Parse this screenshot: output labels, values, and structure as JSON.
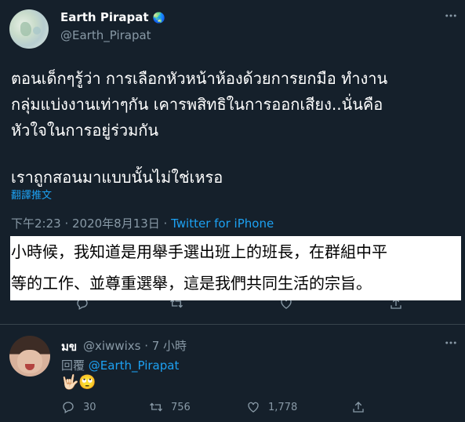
{
  "tweet": {
    "author_name": "Earth Pirapat",
    "verified_emoji": "🌏",
    "handle": "@Earth_Pirapat",
    "text_line1": "ตอนเด็กๆรู้ว่า การเลือกหัวหน้าห้องด้วยการยกมือ ทำงาน",
    "text_line2": "กลุ่มแบ่งงานเท่าๆกัน เคารพสิทธิในการออกเสียง..นั่นคือ",
    "text_line3": "หัวใจในการอยู่ร่วมกัน",
    "text_line4": "เราถูกสอนมาแบบนั้นไม่ใช่เหรอ",
    "translate_label": "翻譯推文",
    "timestamp": "下午2:23 · 2020年8月13日 · ",
    "source": "Twitter for iPhone"
  },
  "translation_overlay": {
    "line1": "小時候，我知道是用舉手選出班上的班長，在群組中平",
    "line2": "等的工作、並尊重選舉，這是我們共同生活的宗旨。"
  },
  "reply": {
    "author_name": "มข",
    "handle_time": "@xiwwixs · 7 小時",
    "replying_prefix": "回覆 ",
    "replying_to": "@Earth_Pirapat",
    "emoji_text": "🤟🏻🙄",
    "reply_count": "30",
    "retweet_count": "756",
    "like_count": "1,778"
  },
  "icons": [
    "more-icon",
    "reply-icon",
    "retweet-icon",
    "like-icon",
    "share-icon"
  ],
  "colors": {
    "background": "#15202b",
    "secondary": "#8899a6",
    "accent": "#1da1f2",
    "divider": "#38444d"
  }
}
